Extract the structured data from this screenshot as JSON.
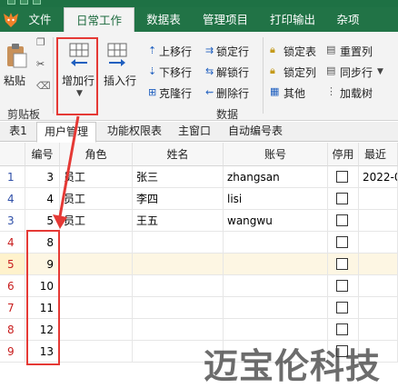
{
  "menu": {
    "items": [
      "文件",
      "日常工作",
      "数据表",
      "管理项目",
      "打印输出",
      "杂项"
    ],
    "active": "日常工作"
  },
  "ribbon": {
    "clipboard": {
      "paste": "粘贴",
      "group": "剪贴板"
    },
    "add_row": "增加行",
    "insert_row": "插入行",
    "move_up": "上移行",
    "move_down": "下移行",
    "clone_row": "克隆行",
    "lock_row": "锁定行",
    "unlock_row": "解锁行",
    "delete_row": "删除行",
    "lock_table": "锁定表",
    "lock_col": "锁定列",
    "other": "其他",
    "reset_col": "重置列",
    "sync_row": "同步行",
    "load_tree": "加载树",
    "data_group": "数据"
  },
  "tabs": [
    "表1",
    "用户管理",
    "功能权限表",
    "主窗口",
    "自动编号表"
  ],
  "active_tab": "用户管理",
  "grid": {
    "columns": [
      "编号",
      "角色",
      "姓名",
      "账号",
      "停用",
      "最近"
    ],
    "rows": [
      {
        "rn": "1",
        "id": "3",
        "role": "员工",
        "name": "张三",
        "account": "zhangsan",
        "recent": "2022-0",
        "new": false
      },
      {
        "rn": "4",
        "id": "4",
        "role": "员工",
        "name": "李四",
        "account": "lisi",
        "recent": "",
        "new": false
      },
      {
        "rn": "3",
        "id": "5",
        "role": "员工",
        "name": "王五",
        "account": "wangwu",
        "recent": "",
        "new": false
      },
      {
        "rn": "4",
        "id": "8",
        "role": "",
        "name": "",
        "account": "",
        "recent": "",
        "new": true
      },
      {
        "rn": "5",
        "id": "9",
        "role": "",
        "name": "",
        "account": "",
        "recent": "",
        "new": true
      },
      {
        "rn": "6",
        "id": "10",
        "role": "",
        "name": "",
        "account": "",
        "recent": "",
        "new": true
      },
      {
        "rn": "7",
        "id": "11",
        "role": "",
        "name": "",
        "account": "",
        "recent": "",
        "new": true
      },
      {
        "rn": "8",
        "id": "12",
        "role": "",
        "name": "",
        "account": "",
        "recent": "",
        "new": true
      },
      {
        "rn": "9",
        "id": "13",
        "role": "",
        "name": "",
        "account": "",
        "recent": "",
        "new": true
      }
    ]
  },
  "watermark": "迈宝伦科技",
  "colors": {
    "menubar": "#217346",
    "annotation": "#e53935",
    "row_number": "#2f4fa8",
    "new_row_number": "#c81e1e",
    "selected_row": "#fdf6e3"
  }
}
